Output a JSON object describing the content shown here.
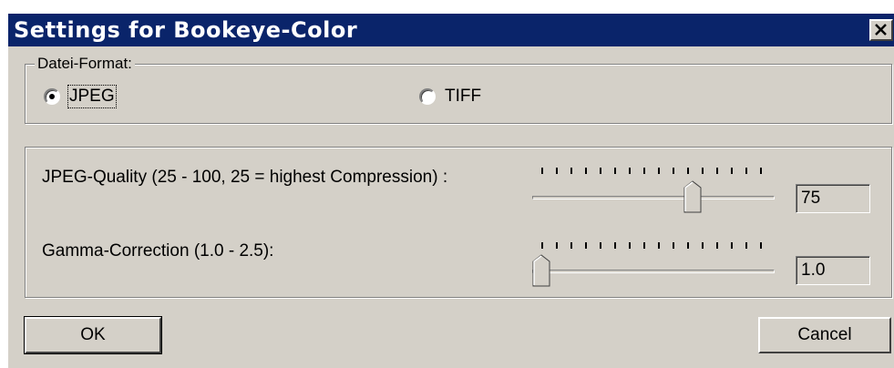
{
  "window": {
    "title": "Settings for Bookeye-Color",
    "close_glyph": "✕"
  },
  "format_group": {
    "legend": "Datei-Format:",
    "options": [
      {
        "label": "JPEG",
        "checked": true
      },
      {
        "label": "TIFF",
        "checked": false
      }
    ]
  },
  "settings_group": {
    "jpeg_quality": {
      "label": "JPEG-Quality (25 - 100, 25 = highest Compression) :",
      "min": 25,
      "max": 100,
      "value": "75"
    },
    "gamma": {
      "label": "Gamma-Correction (1.0 - 2.5):",
      "min": 1.0,
      "max": 2.5,
      "value": "1.0"
    }
  },
  "buttons": {
    "ok": "OK",
    "cancel": "Cancel"
  }
}
